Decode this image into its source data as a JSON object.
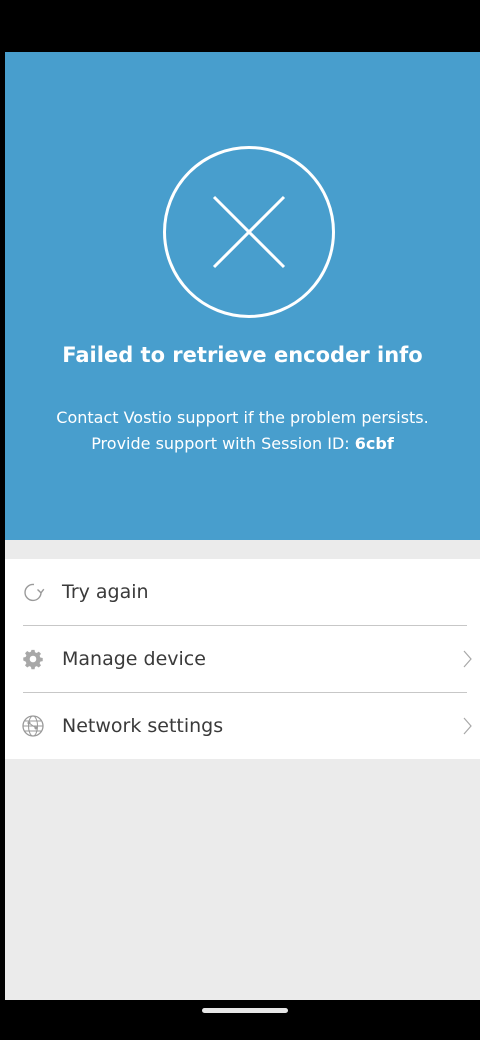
{
  "hero": {
    "title": "Failed to retrieve encoder info",
    "message_line1": "Contact Vostio support if the problem persists.",
    "message_line2_prefix": "Provide support with Session ID: ",
    "session_id": "6cbf",
    "icon": "close-circle-icon",
    "background": "#489ecd"
  },
  "menu": {
    "items": [
      {
        "label": "Try again",
        "icon": "refresh-icon",
        "has_chevron": false
      },
      {
        "label": "Manage device",
        "icon": "gear-icon",
        "has_chevron": true
      },
      {
        "label": "Network settings",
        "icon": "globe-network-icon",
        "has_chevron": true
      }
    ]
  }
}
